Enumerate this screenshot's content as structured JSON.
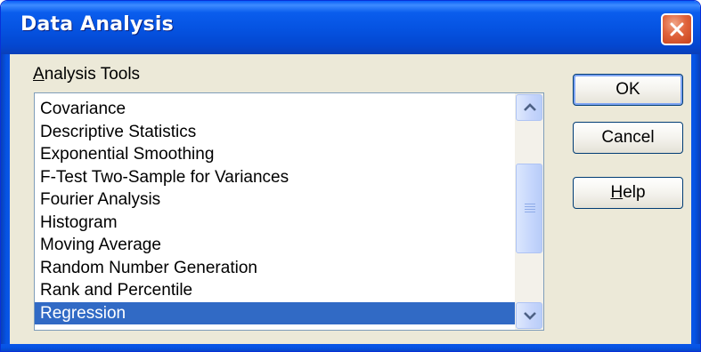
{
  "window": {
    "title": "Data Analysis"
  },
  "tools": {
    "label": "Analysis Tools",
    "label_accel": "A",
    "label_rest": "nalysis Tools",
    "items": [
      "Covariance",
      "Descriptive Statistics",
      "Exponential Smoothing",
      "F-Test Two-Sample for Variances",
      "Fourier Analysis",
      "Histogram",
      "Moving Average",
      "Random Number Generation",
      "Rank and Percentile",
      "Regression"
    ],
    "selected": "Regression"
  },
  "buttons": {
    "ok": "OK",
    "cancel": "Cancel",
    "help": "Help",
    "help_accel": "H",
    "help_rest": "elp"
  },
  "colors": {
    "title_bar": "#0553e3",
    "selection": "#316ac5",
    "dialog_face": "#ece9d8",
    "close_button": "#e0643c"
  },
  "icons": [
    "close-icon",
    "scroll-up-icon",
    "scroll-down-icon",
    "scrollbar-grip-icon"
  ]
}
